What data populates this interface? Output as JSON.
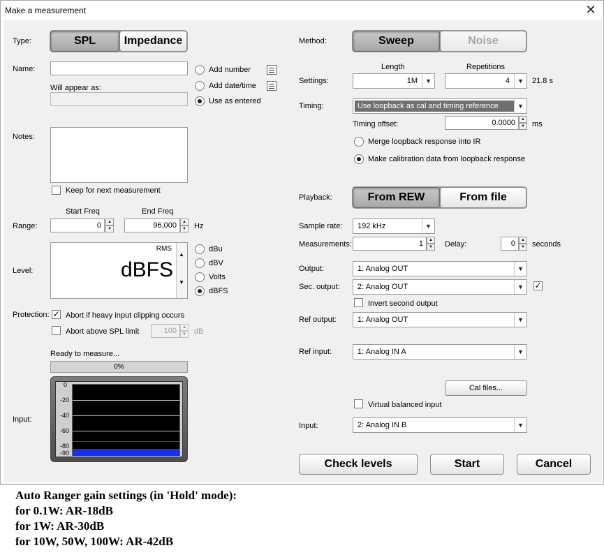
{
  "window": {
    "title": "Make a measurement",
    "close_glyph": "✕"
  },
  "type": {
    "label": "Type:",
    "spl": "SPL",
    "impedance": "Impedance"
  },
  "name": {
    "label": "Name:",
    "value": "",
    "appear_label": "Will appear as:",
    "appear_value": ""
  },
  "naming": {
    "add_number": "Add number",
    "add_date": "Add date/time",
    "use_entered": "Use as entered",
    "selected": "Use as entered"
  },
  "notes": {
    "label": "Notes:",
    "value": "",
    "keep_label": "Keep for next measurement"
  },
  "range": {
    "label": "Range:",
    "start_header": "Start Freq",
    "start_value": "0",
    "end_header": "End Freq",
    "end_value": "96,000",
    "unit": "Hz"
  },
  "level": {
    "label": "Level:",
    "rms": "RMS",
    "big": "dBFS",
    "options": [
      "dBu",
      "dBV",
      "Volts",
      "dBFS"
    ],
    "selected": "dBFS"
  },
  "protection": {
    "label": "Protection:",
    "abort_clipping": "Abort if heavy input clipping occurs",
    "abort_clipping_checked": true,
    "abort_spl": "Abort above SPL limit",
    "spl_value": "100",
    "spl_unit": "dB"
  },
  "status": {
    "text": "Ready to measure...",
    "progress_text": "0%",
    "progress": 0
  },
  "input_meter": {
    "label": "Input:",
    "ticks": [
      "0",
      "-20",
      "-40",
      "-60",
      "-80",
      "-90"
    ]
  },
  "method": {
    "label": "Method:",
    "sweep": "Sweep",
    "noise": "Noise"
  },
  "settings": {
    "label": "Settings:",
    "length_header": "Length",
    "length_value": "1M",
    "reps_header": "Repetitions",
    "reps_value": "4",
    "duration": "21.8 s"
  },
  "timing": {
    "label": "Timing:",
    "value": "Use loopback as cal and timing reference",
    "offset_label": "Timing offset:",
    "offset_value": "0.0000",
    "offset_unit": "ms",
    "merge": "Merge loopback response into IR",
    "make_cal": "Make calibration data from loopback response"
  },
  "playback": {
    "label": "Playback:",
    "from_rew": "From REW",
    "from_file": "From file"
  },
  "sample_rate": {
    "label": "Sample rate:",
    "value": "192 kHz"
  },
  "measurements": {
    "label": "Measurements:",
    "value": "1",
    "delay_label": "Delay:",
    "delay_value": "0",
    "delay_unit": "seconds"
  },
  "output": {
    "label": "Output:",
    "value": "1: Analog OUT"
  },
  "sec_output": {
    "label": "Sec. output:",
    "value": "2: Analog OUT",
    "checked": true,
    "invert_label": "Invert second output"
  },
  "ref_output": {
    "label": "Ref output:",
    "value": "1: Analog OUT"
  },
  "ref_input": {
    "label": "Ref input:",
    "value": "1: Analog IN A"
  },
  "cal_files": "Cal files...",
  "virtual_balanced": "Virtual balanced input",
  "input": {
    "label": "Input:",
    "value": "2: Analog IN B"
  },
  "buttons": {
    "check_levels": "Check levels",
    "start": "Start",
    "cancel": "Cancel"
  },
  "annotation": [
    "Auto Ranger gain settings (in 'Hold' mode):",
    "for 0.1W: AR-18dB",
    "for 1W: AR-30dB",
    "for 10W, 50W, 100W: AR-42dB"
  ]
}
